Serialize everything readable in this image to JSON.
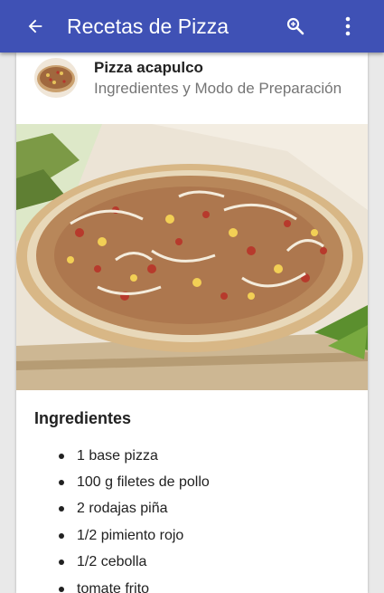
{
  "appbar": {
    "title": "Recetas de Pizza",
    "nav_icon": "arrow-back-icon",
    "actions": [
      "search-zoom-icon",
      "more-vert-icon"
    ],
    "color": "#3f51b5"
  },
  "recipe": {
    "name": "Pizza acapulco",
    "subtitle": "Ingredientes y Modo de Preparación",
    "image": "pizza-photo"
  },
  "ingredients": {
    "title": "Ingredientes",
    "items": [
      "1 base pizza",
      "100 g filetes de pollo",
      "2 rodajas piña",
      "1/2 pimiento rojo",
      "1/2 cebolla",
      "tomate frito"
    ]
  }
}
